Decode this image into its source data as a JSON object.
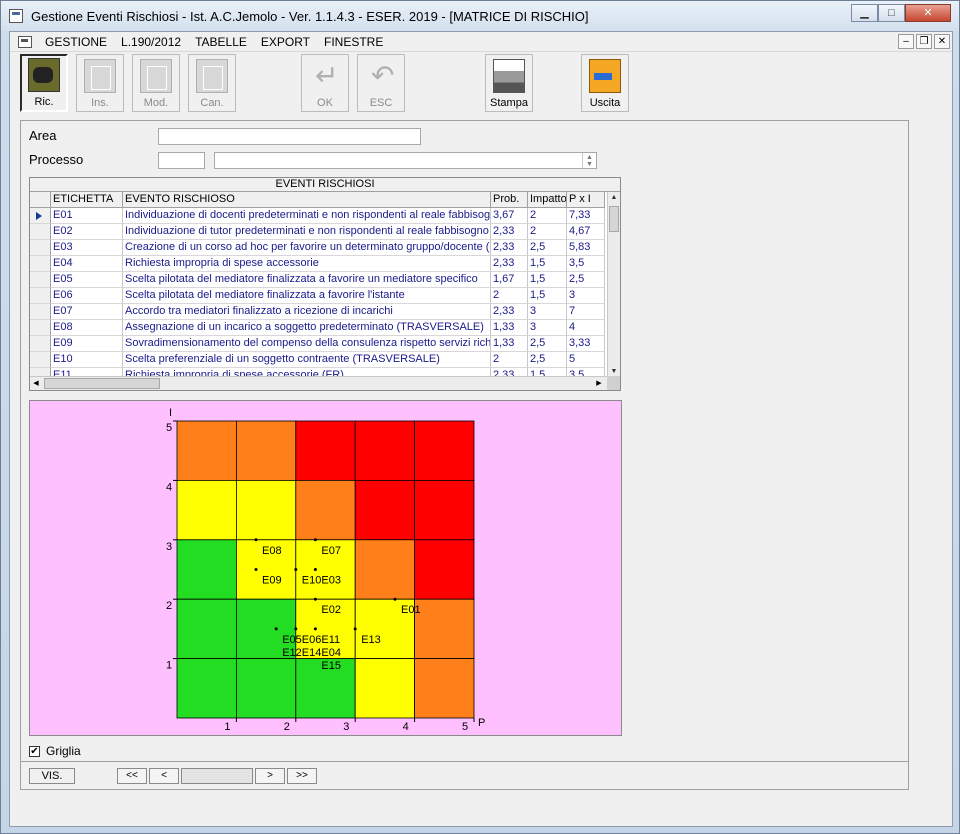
{
  "window": {
    "title": "Gestione Eventi Rischiosi - Ist. A.C.Jemolo - Ver. 1.1.4.3 - ESER. 2019 - [MATRICE DI RISCHIO]"
  },
  "menu": [
    "GESTIONE",
    "L.190/2012",
    "TABELLE",
    "EXPORT",
    "FINESTRE"
  ],
  "toolbar": {
    "ric": "Ric.",
    "ins": "Ins.",
    "mod": "Mod.",
    "can": "Can.",
    "ok": "OK",
    "esc": "ESC",
    "stampa": "Stampa",
    "uscita": "Uscita"
  },
  "form": {
    "area_label": "Area",
    "area_value": "",
    "processo_label": "Processo",
    "processo_code": "",
    "processo_value": ""
  },
  "grid": {
    "title": "EVENTI RISCHIOSI",
    "headers": [
      "ETICHETTA",
      "EVENTO RISCHIOSO",
      "Prob.",
      "Impatto",
      "P x I"
    ],
    "rows": [
      [
        "E01",
        "Individuazione di docenti predeterminati e non rispondenti al reale fabbisogno",
        "3,67",
        "2",
        "7,33"
      ],
      [
        "E02",
        "Individuazione di tutor predeterminati e non rispondenti al reale fabbisogno",
        "2,33",
        "2",
        "4,67"
      ],
      [
        "E03",
        "Creazione di un corso ad hoc per favorire un determinato gruppo/docente (cc",
        "2,33",
        "2,5",
        "5,83"
      ],
      [
        "E04",
        "Richiesta impropria di spese accessorie",
        "2,33",
        "1,5",
        "3,5"
      ],
      [
        "E05",
        "Scelta pilotata del mediatore finalizzata a favorire un mediatore specifico",
        "1,67",
        "1,5",
        "2,5"
      ],
      [
        "E06",
        "Scelta pilotata del mediatore finalizzata a favorire l'istante",
        "2",
        "1,5",
        "3"
      ],
      [
        "E07",
        "Accordo tra mediatori finalizzato a ricezione di incarichi",
        "2,33",
        "3",
        "7"
      ],
      [
        "E08",
        "Assegnazione di un incarico a soggetto predeterminato (TRASVERSALE)",
        "1,33",
        "3",
        "4"
      ],
      [
        "E09",
        "Sovradimensionamento del compenso della consulenza rispetto servizi richies",
        "1,33",
        "2,5",
        "3,33"
      ],
      [
        "E10",
        "Scelta preferenziale di un soggetto contraente (TRASVERSALE)",
        "2",
        "2,5",
        "5"
      ],
      [
        "E11",
        "Richiesta impropria di spese accessorie (FR)",
        "2,33",
        "1,5",
        "3,5"
      ]
    ]
  },
  "chart_data": {
    "type": "heatmap",
    "xlabel": "P",
    "ylabel": "I",
    "xlim": [
      0,
      5
    ],
    "ylim": [
      0,
      5
    ],
    "x_ticks": [
      "1",
      "2",
      "3",
      "4",
      "5"
    ],
    "y_ticks": [
      "1",
      "2",
      "3",
      "4",
      "5"
    ],
    "colors": {
      "green": "#22dd22",
      "yellow": "#ffff00",
      "orange": "#ff7f1a",
      "red": "#ff0000"
    },
    "cells": [
      [
        "orange",
        "orange",
        "red",
        "red",
        "red"
      ],
      [
        "yellow",
        "yellow",
        "orange",
        "red",
        "red"
      ],
      [
        "green",
        "yellow",
        "yellow",
        "orange",
        "red"
      ],
      [
        "green",
        "green",
        "yellow",
        "yellow",
        "orange"
      ],
      [
        "green",
        "green",
        "green",
        "yellow",
        "orange"
      ]
    ],
    "points": [
      {
        "label": "E08",
        "x": 1.33,
        "y": 3
      },
      {
        "label": "E07",
        "x": 2.33,
        "y": 3
      },
      {
        "label": "E09",
        "x": 1.33,
        "y": 2.5
      },
      {
        "label": "E10",
        "x": 2,
        "y": 2.5
      },
      {
        "label": "E03",
        "x": 2.33,
        "y": 2.5
      },
      {
        "label": "E02",
        "x": 2.33,
        "y": 2
      },
      {
        "label": "E01",
        "x": 3.67,
        "y": 2
      },
      {
        "label": "E05",
        "x": 1.67,
        "y": 1.5
      },
      {
        "label": "E06",
        "x": 2,
        "y": 1.5
      },
      {
        "label": "E12",
        "x": 1.67,
        "y": 1.5
      },
      {
        "label": "E14",
        "x": 2,
        "y": 1.5
      },
      {
        "label": "E11",
        "x": 2.33,
        "y": 1.5
      },
      {
        "label": "E04",
        "x": 2.33,
        "y": 1.5
      },
      {
        "label": "E15",
        "x": 2.33,
        "y": 1.5
      },
      {
        "label": "E13",
        "x": 3,
        "y": 1.5
      }
    ],
    "grid": true
  },
  "bottom": {
    "griglia_label": "Griglia",
    "griglia_checked": "✔",
    "vis_label": "VIS.",
    "nav_first": "<<",
    "nav_prev": "<",
    "nav_next": ">",
    "nav_last": ">>"
  }
}
